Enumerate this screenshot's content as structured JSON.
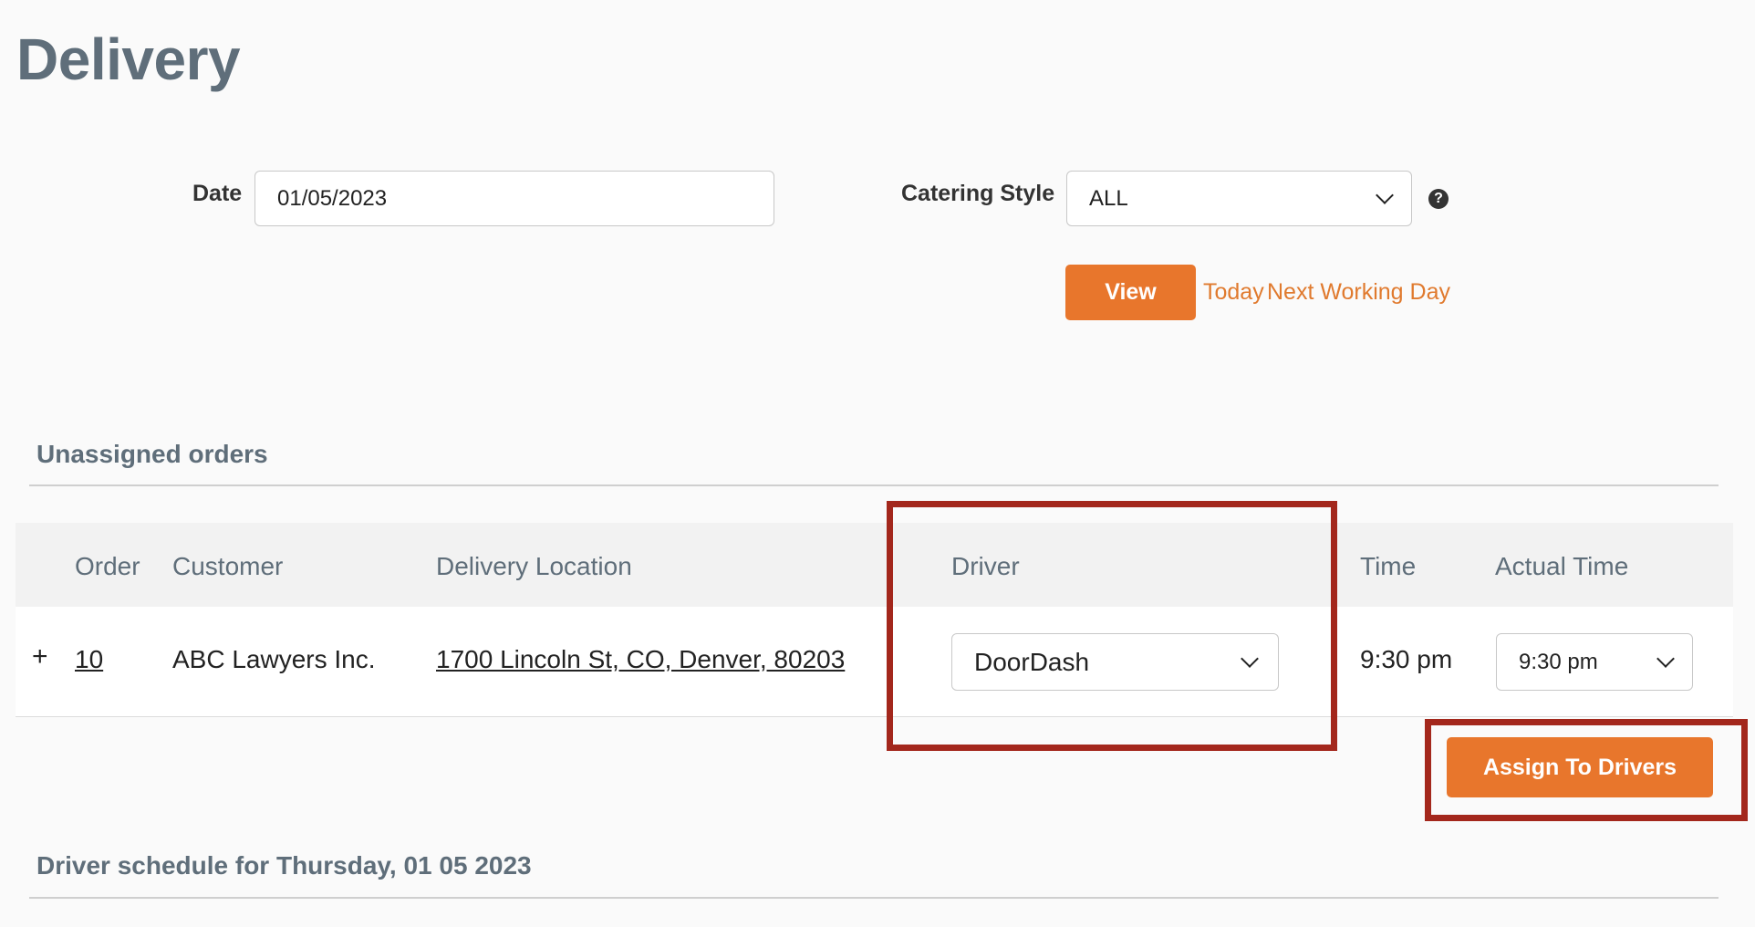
{
  "page": {
    "title": "Delivery"
  },
  "filters": {
    "date_label": "Date",
    "date_value": "01/05/2023",
    "catering_style_label": "Catering Style",
    "catering_style_value": "ALL",
    "help_icon": "question-circle-icon",
    "view_button": "View",
    "today_link": "Today",
    "next_working_day_link": "Next Working Day"
  },
  "unassigned": {
    "title": "Unassigned orders",
    "columns": {
      "order": "Order",
      "customer": "Customer",
      "location": "Delivery Location",
      "driver": "Driver",
      "time": "Time",
      "actual_time": "Actual Time"
    },
    "rows": [
      {
        "expand": "+",
        "order": "10",
        "customer": "ABC Lawyers Inc.",
        "location": "1700 Lincoln St, CO, Denver, 80203",
        "driver": "DoorDash",
        "time": "9:30 pm",
        "actual_time": "9:30 pm"
      }
    ],
    "assign_button": "Assign To Drivers"
  },
  "schedule": {
    "title": "Driver schedule for Thursday, 01 05 2023"
  },
  "colors": {
    "accent": "#e8762c",
    "heading": "#5f6e7a",
    "highlight": "#a3271c"
  }
}
